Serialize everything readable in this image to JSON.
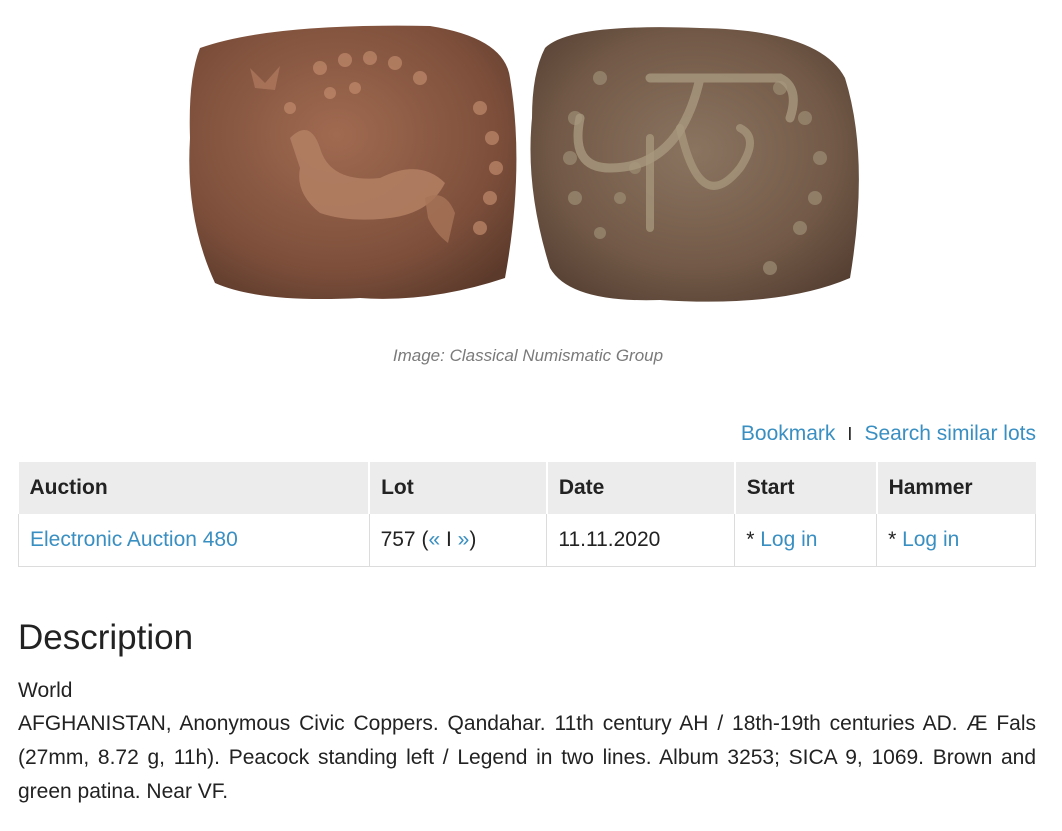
{
  "image": {
    "obverse_icon": "coin-obverse-peacock",
    "reverse_icon": "coin-reverse-legend",
    "caption": "Image: Classical Numismatic Group"
  },
  "actions": {
    "bookmark": "Bookmark",
    "separator": "I",
    "search_similar": "Search similar lots"
  },
  "table": {
    "headers": [
      "Auction",
      "Lot",
      "Date",
      "Start",
      "Hammer"
    ],
    "row": {
      "auction": "Electronic Auction 480",
      "lot_number": "757",
      "lot_open": "(",
      "prev": "«",
      "lot_sep": "I",
      "next": "»",
      "lot_close": ")",
      "date": "11.11.2020",
      "start_prefix": "* ",
      "start_link": "Log in",
      "hammer_prefix": "* ",
      "hammer_link": "Log in"
    }
  },
  "description": {
    "title": "Description",
    "category": "World",
    "text": "AFGHANISTAN, Anonymous Civic Coppers. Qandahar. 11th century AH / 18th-19th centuries AD. Æ Fals (27mm, 8.72 g, 11h). Peacock standing left / Legend in two lines. Album 3253; SICA 9, 1069. Brown and green patina. Near VF."
  },
  "colors": {
    "link": "#3a8fc2",
    "header_bg": "#ececec",
    "coin_copper": "#8a5a44",
    "coin_patina": "#6f7a5c"
  }
}
